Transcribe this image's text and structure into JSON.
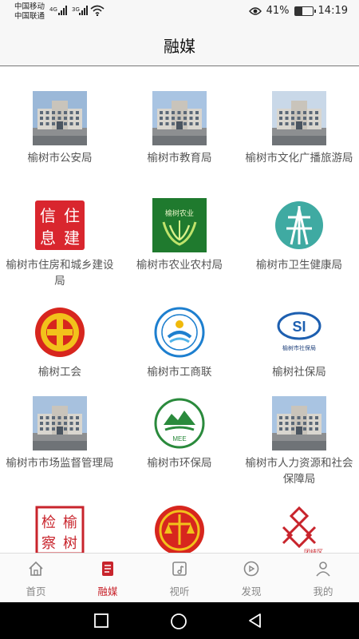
{
  "status_bar": {
    "carrier_1": "中国移动",
    "carrier_2": "中国联通",
    "network_1": "4G",
    "network_2": "3G",
    "battery": "41%",
    "battery_level": 0.41,
    "time": "14:19"
  },
  "header": {
    "title": "融媒"
  },
  "agencies": [
    {
      "label": "榆树市公安局",
      "icon": "government-building-photo"
    },
    {
      "label": "榆树市教育局",
      "icon": "government-building-photo"
    },
    {
      "label": "榆树市文化广播旅游局",
      "icon": "government-building-photo"
    },
    {
      "label": "榆树市住房和城乡建设局",
      "icon": "housing-seal-logo",
      "logo_text": [
        "信",
        "住",
        "息",
        "建"
      ]
    },
    {
      "label": "榆树市农业农村局",
      "icon": "agriculture-logo",
      "logo_text": "榆树农业"
    },
    {
      "label": "榆树市卫生健康局",
      "icon": "health-logo"
    },
    {
      "label": "榆树工会",
      "icon": "trade-union-logo"
    },
    {
      "label": "榆树市工商联",
      "icon": "federation-logo"
    },
    {
      "label": "榆树社保局",
      "icon": "social-security-logo",
      "logo_text": "榆树市社保局",
      "logo_mark": "SI"
    },
    {
      "label": "榆树市市场监督管理局",
      "icon": "government-building-photo"
    },
    {
      "label": "榆树市环保局",
      "icon": "environment-logo",
      "logo_mark": "MEE"
    },
    {
      "label": "榆树市人力资源和社会保障局",
      "icon": "government-building-photo"
    },
    {
      "label": "",
      "icon": "procuratorate-seal-logo",
      "logo_text": [
        "榆",
        "检",
        "树",
        "察"
      ]
    },
    {
      "label": "",
      "icon": "court-emblem-logo"
    },
    {
      "label": "",
      "icon": "community-logo",
      "logo_text": "团结区"
    }
  ],
  "tabs": [
    {
      "label": "首页",
      "icon": "home-icon",
      "active": false
    },
    {
      "label": "融媒",
      "icon": "document-icon",
      "active": true
    },
    {
      "label": "视听",
      "icon": "media-icon",
      "active": false
    },
    {
      "label": "发现",
      "icon": "discover-icon",
      "active": false
    },
    {
      "label": "我的",
      "icon": "user-icon",
      "active": false
    }
  ],
  "colors": {
    "accent": "#c8242c",
    "tab_inactive": "#888888",
    "text": "#555555"
  }
}
